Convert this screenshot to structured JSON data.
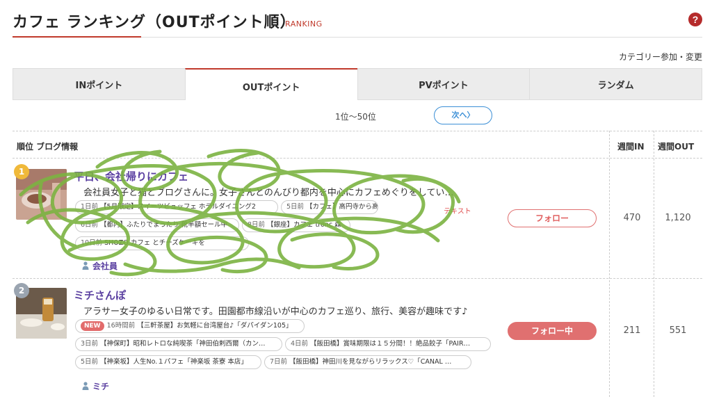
{
  "header": {
    "title": "カフェ ランキング（OUTポイント順）",
    "subtitle": "RANKING",
    "help_glyph": "?"
  },
  "category_link": "カテゴリー参加・変更",
  "tabs": [
    {
      "label": "INポイント",
      "active": false
    },
    {
      "label": "OUTポイント",
      "active": true
    },
    {
      "label": "PVポイント",
      "active": false
    },
    {
      "label": "ランダム",
      "active": false
    }
  ],
  "pager": {
    "range": "1位〜50位",
    "next_label": "次へ〉"
  },
  "table_headers": {
    "rank_info": "順位  ブログ情報",
    "weekly_in": "週間IN",
    "weekly_out": "週間OUT"
  },
  "rows": [
    {
      "rank": "1",
      "rank_color": "#f0b93a",
      "name": "平日、会社帰りにカフェ",
      "description": "会社員女子と猫とブログさんに。女子さんとのんびり都内を中心にカフェめぐりをしてい…",
      "posts": [
        {
          "ago": "1日前",
          "text": "【5月限定】スイーツビュッフェ ホテルダイニング2"
        },
        {
          "ago": "5日前",
          "text": "【カフェ】高円寺から高円寺へ"
        },
        {
          "ago": "6日前",
          "text": "【都内】ふたりでまったり 靴半額セール中"
        },
        {
          "ago": "8日前",
          "text": "【銀座】カフェ tronc 森"
        },
        {
          "ago": "10日前",
          "text": "SHOZO カフェ とチーズケーキを"
        }
      ],
      "extra_label": "テキスト",
      "author": "会社員",
      "follow_label": "フォロー",
      "follow_state": "outline",
      "weekly_in": "470",
      "weekly_out": "1,120"
    },
    {
      "rank": "2",
      "rank_color": "#9aa4b0",
      "name": "ミチさんぽ",
      "description": "アラサー女子のゆるい日常です。田園都市線沿いが中心のカフェ巡り、旅行、美容が趣味です♪",
      "new_badge": "NEW",
      "posts": [
        {
          "ago": "16時間前",
          "text": "【三軒茶屋】お気軽に台湾屋台♪「ダパイダン105」"
        },
        {
          "ago": "3日前",
          "text": "【神保町】昭和レトロな純喫茶「神田伯剌西爾（カン…"
        },
        {
          "ago": "4日前",
          "text": "【飯田橋】賞味期限は１５分間！！絶品餃子「PAIR…"
        },
        {
          "ago": "5日前",
          "text": "【神楽坂】人生No.１パフェ「神楽坂 茶寮 本店」"
        },
        {
          "ago": "7日前",
          "text": "【飯田橋】神田川を見ながらリラックス♡「CANAL …"
        }
      ],
      "author": "ミチ",
      "follow_label": "フォロー中",
      "follow_state": "filled",
      "weekly_in": "211",
      "weekly_out": "551"
    }
  ],
  "colors": {
    "accent": "#c0392b",
    "link": "#5a3fa0",
    "follow": "#e07070",
    "pager": "#3b8fd6",
    "scribble": "#7cb342"
  }
}
